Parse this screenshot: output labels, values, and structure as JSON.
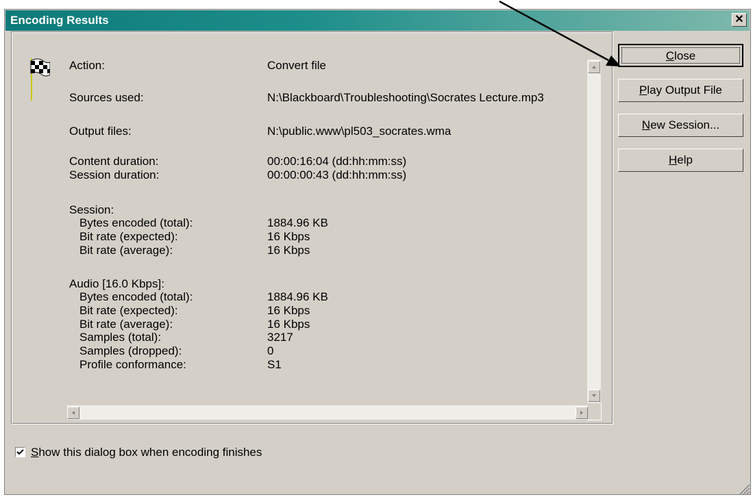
{
  "window": {
    "title": "Encoding Results",
    "close_glyph": "✕"
  },
  "details": {
    "rows": [
      {
        "label": "Action:",
        "value": "Convert file"
      },
      {
        "label": "Sources used:",
        "value": "N:\\Blackboard\\Troubleshooting\\Socrates Lecture.mp3"
      },
      {
        "label": "Output files:",
        "value": "N:\\public.www\\pl503_socrates.wma"
      },
      {
        "label": "Content duration:",
        "value": "00:00:16:04  (dd:hh:mm:ss)"
      },
      {
        "label": "Session duration:",
        "value": "00:00:00:43  (dd:hh:mm:ss)"
      },
      {
        "label": "Session:",
        "value": ""
      },
      {
        "label": "  Bytes encoded (total):",
        "value": "1884.96 KB"
      },
      {
        "label": "  Bit rate (expected):",
        "value": "16 Kbps"
      },
      {
        "label": "  Bit rate (average):",
        "value": "16 Kbps"
      },
      {
        "label": "Audio [16.0 Kbps]:",
        "value": ""
      },
      {
        "label": "  Bytes encoded (total):",
        "value": "1884.96 KB"
      },
      {
        "label": "  Bit rate (expected):",
        "value": "16 Kbps"
      },
      {
        "label": "  Bit rate (average):",
        "value": "16 Kbps"
      },
      {
        "label": "  Samples (total):",
        "value": "3217"
      },
      {
        "label": "  Samples (dropped):",
        "value": "0"
      },
      {
        "label": "  Profile conformance:",
        "value": "S1"
      }
    ]
  },
  "buttons": {
    "close": {
      "mnemonic": "C",
      "rest": "lose"
    },
    "play": {
      "mnemonic": "P",
      "rest": "lay Output File"
    },
    "new_session": {
      "mnemonic": "N",
      "rest": "ew Session..."
    },
    "help": {
      "mnemonic": "H",
      "rest": "elp"
    }
  },
  "checkbox": {
    "mnemonic": "S",
    "rest": "how this dialog box when encoding finishes",
    "checked": true
  }
}
